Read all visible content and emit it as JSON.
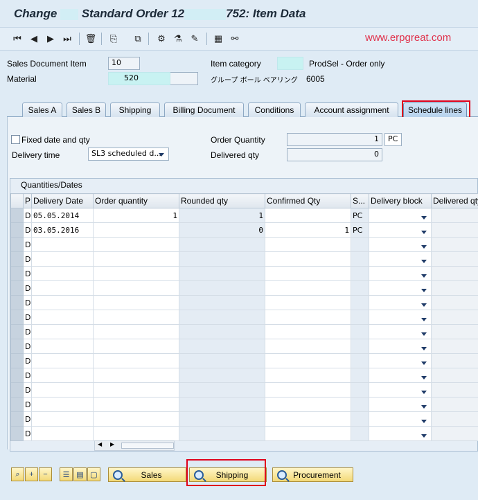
{
  "title": {
    "part1": "Change",
    "part2": "Standard Order 12",
    "part3": "752: Item Data"
  },
  "watermark": "www.erpgreat.com",
  "toolbar_icons": [
    "first-page-icon",
    "previous-page-icon",
    "next-page-icon",
    "last-page-icon",
    "delete-icon",
    "copy-icon",
    "display-icon",
    "config-icon",
    "materials-icon",
    "edit-icon",
    "calculator-icon",
    "link-icon"
  ],
  "header": {
    "sales_doc_item_label": "Sales Document Item",
    "sales_doc_item_value": "10",
    "material_label": "Material",
    "material_value": "520",
    "item_category_label": "Item category",
    "item_category_text": "ProdSel - Order only",
    "group_label": "グループ ボール ベアリング",
    "group_value": "6005"
  },
  "tabs": [
    "Sales A",
    "Sales B",
    "Shipping",
    "Billing Document",
    "Conditions",
    "Account assignment",
    "Schedule lines"
  ],
  "active_tab": "Schedule lines",
  "schedule": {
    "fixed_label": "Fixed date and qty",
    "fixed_checked": false,
    "delivery_time_label": "Delivery time",
    "delivery_time_value": "SL3 scheduled d...",
    "order_qty_label": "Order Quantity",
    "order_qty_value": "1",
    "order_qty_unit": "PC",
    "delivered_qty_label": "Delivered qty",
    "delivered_qty_value": "0"
  },
  "table": {
    "title": "Quantities/Dates",
    "columns": [
      "P",
      "Delivery Date",
      "Order quantity",
      "Rounded qty",
      "Confirmed Qty",
      "S...",
      "Delivery block",
      "Delivered qty"
    ],
    "rows": [
      {
        "p": "D",
        "date": "05.05.2014",
        "order_qty": "1",
        "rounded_qty": "1",
        "confirmed_qty": "",
        "unit": "PC"
      },
      {
        "p": "D",
        "date": "03.05.2016",
        "order_qty": "",
        "rounded_qty": "0",
        "confirmed_qty": "1",
        "unit": "PC"
      },
      {
        "p": "D",
        "date": "",
        "order_qty": "",
        "rounded_qty": "",
        "confirmed_qty": "",
        "unit": ""
      },
      {
        "p": "D",
        "date": "",
        "order_qty": "",
        "rounded_qty": "",
        "confirmed_qty": "",
        "unit": ""
      },
      {
        "p": "D",
        "date": "",
        "order_qty": "",
        "rounded_qty": "",
        "confirmed_qty": "",
        "unit": ""
      },
      {
        "p": "D",
        "date": "",
        "order_qty": "",
        "rounded_qty": "",
        "confirmed_qty": "",
        "unit": ""
      },
      {
        "p": "D",
        "date": "",
        "order_qty": "",
        "rounded_qty": "",
        "confirmed_qty": "",
        "unit": ""
      },
      {
        "p": "D",
        "date": "",
        "order_qty": "",
        "rounded_qty": "",
        "confirmed_qty": "",
        "unit": ""
      },
      {
        "p": "D",
        "date": "",
        "order_qty": "",
        "rounded_qty": "",
        "confirmed_qty": "",
        "unit": ""
      },
      {
        "p": "D",
        "date": "",
        "order_qty": "",
        "rounded_qty": "",
        "confirmed_qty": "",
        "unit": ""
      },
      {
        "p": "D",
        "date": "",
        "order_qty": "",
        "rounded_qty": "",
        "confirmed_qty": "",
        "unit": ""
      },
      {
        "p": "D",
        "date": "",
        "order_qty": "",
        "rounded_qty": "",
        "confirmed_qty": "",
        "unit": ""
      },
      {
        "p": "D",
        "date": "",
        "order_qty": "",
        "rounded_qty": "",
        "confirmed_qty": "",
        "unit": ""
      },
      {
        "p": "D",
        "date": "",
        "order_qty": "",
        "rounded_qty": "",
        "confirmed_qty": "",
        "unit": ""
      },
      {
        "p": "D",
        "date": "",
        "order_qty": "",
        "rounded_qty": "",
        "confirmed_qty": "",
        "unit": ""
      },
      {
        "p": "D",
        "date": "",
        "order_qty": "",
        "rounded_qty": "",
        "confirmed_qty": "",
        "unit": ""
      }
    ]
  },
  "buttons": {
    "sales": "Sales",
    "shipping": "Shipping",
    "procurement": "Procurement"
  },
  "highlight_color": "#e0001b"
}
